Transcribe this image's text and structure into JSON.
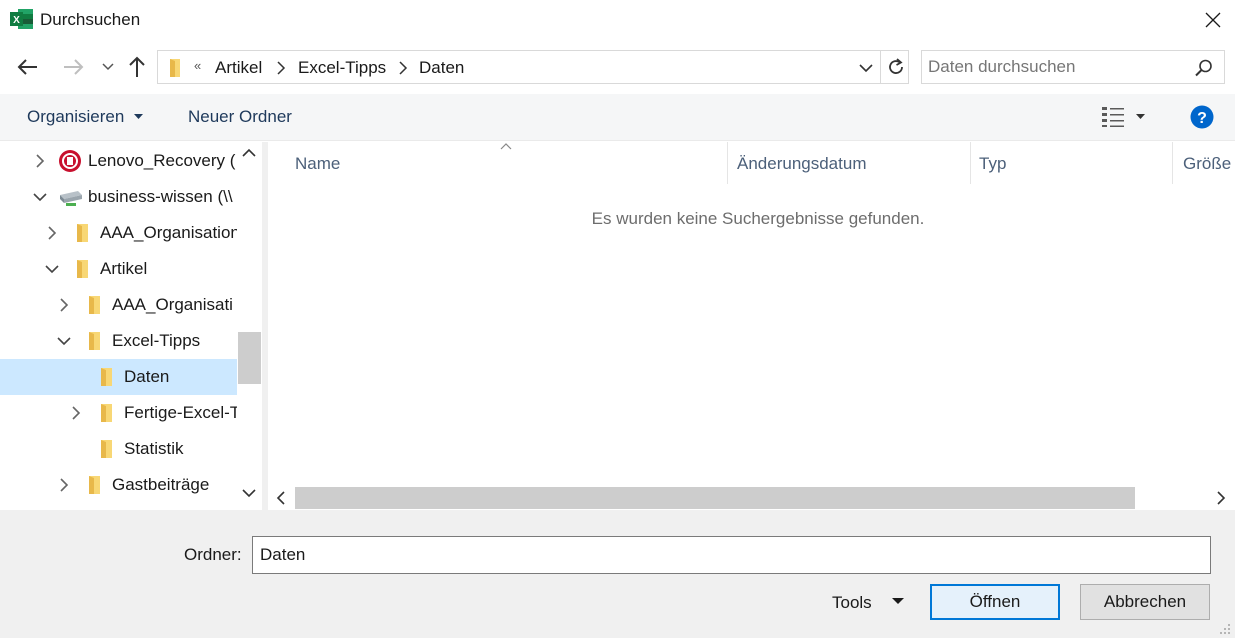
{
  "window": {
    "title": "Durchsuchen",
    "app_icon": "excel-icon"
  },
  "nav": {
    "back_icon": "arrow-left-icon",
    "forward_icon": "arrow-right-icon",
    "recent_icon": "chevron-down-icon",
    "up_icon": "arrow-up-icon",
    "overflow": "«",
    "breadcrumbs": [
      "Artikel",
      "Excel-Tipps",
      "Daten"
    ],
    "refresh_icon": "refresh-icon"
  },
  "search": {
    "placeholder": "Daten durchsuchen",
    "value": ""
  },
  "toolbar": {
    "organize_label": "Organisieren",
    "new_folder_label": "Neuer Ordner",
    "view_icon": "details-view-icon",
    "help_icon": "help-icon"
  },
  "tree": {
    "items": [
      {
        "label": "Lenovo_Recovery (",
        "icon": "recovery-drive-icon",
        "state": "collapsed"
      },
      {
        "label": "business-wissen (\\\\",
        "icon": "network-drive-icon",
        "state": "expanded"
      },
      {
        "label": "AAA_Organisation",
        "icon": "folder-icon",
        "state": "collapsed"
      },
      {
        "label": "Artikel",
        "icon": "folder-icon",
        "state": "expanded"
      },
      {
        "label": "AAA_Organisati",
        "icon": "folder-icon",
        "state": "collapsed"
      },
      {
        "label": "Excel-Tipps",
        "icon": "folder-icon",
        "state": "expanded"
      },
      {
        "label": "Daten",
        "icon": "folder-icon",
        "state": "none",
        "selected": true
      },
      {
        "label": "Fertige-Excel-T",
        "icon": "folder-icon",
        "state": "collapsed"
      },
      {
        "label": "Statistik",
        "icon": "folder-icon",
        "state": "none"
      },
      {
        "label": "Gastbeiträge",
        "icon": "folder-icon",
        "state": "collapsed"
      }
    ]
  },
  "filelist": {
    "columns": [
      "Name",
      "Änderungsdatum",
      "Typ",
      "Größe"
    ],
    "empty_message": "Es wurden keine Suchergebnisse gefunden."
  },
  "footer": {
    "folder_label": "Ordner:",
    "folder_value": "Daten",
    "tools_label": "Tools",
    "open_label": "Öffnen",
    "cancel_label": "Abbrechen"
  },
  "colors": {
    "accent": "#0078d7",
    "selection": "#cce8ff",
    "toolbar_text": "#1e395b",
    "folder": "#f8d775"
  }
}
